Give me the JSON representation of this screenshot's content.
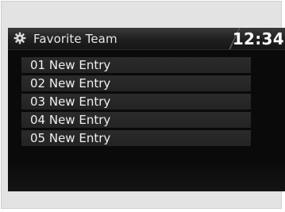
{
  "header": {
    "title": "Favorite Team",
    "icon": "gear-icon",
    "clock": "12:34"
  },
  "list": {
    "items": [
      {
        "label": "01 New Entry"
      },
      {
        "label": "02 New Entry"
      },
      {
        "label": "03 New Entry"
      },
      {
        "label": "04 New Entry"
      },
      {
        "label": "05 New Entry"
      }
    ]
  },
  "colors": {
    "screen_background": "#0a0a0a",
    "item_background": "#262626",
    "text": "#f0f0f0",
    "frame": "#e3e3e3"
  }
}
